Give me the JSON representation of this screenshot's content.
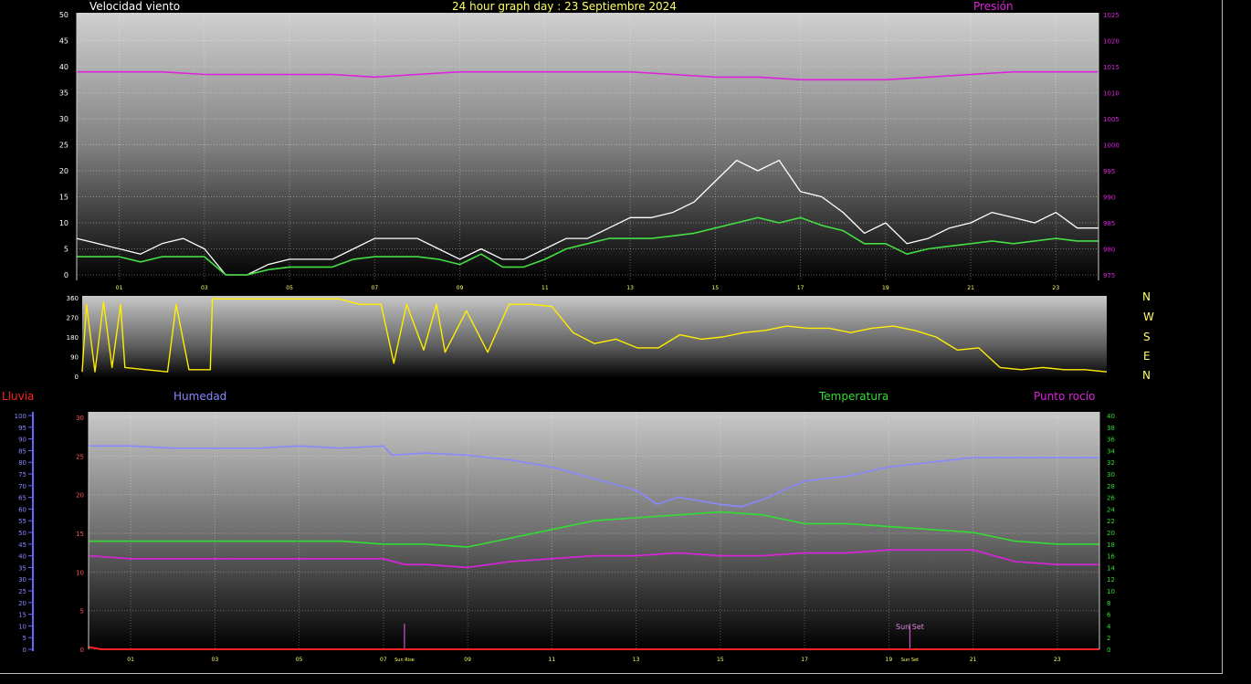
{
  "header": {
    "wind_title": "Velocidad viento",
    "date_title": "24 hour graph day : 23 Septiembre 2024",
    "pressure_title": "Presión"
  },
  "colors": {
    "wind": "#ffffff",
    "wind_avg": "#44dd44",
    "pressure": "#dd22dd",
    "direction": "#ffee00",
    "humidity": "#8888ff",
    "temperature": "#33dd33",
    "dewpoint": "#dd22dd",
    "rain": "#ff2222",
    "sun_marker": "#cc55cc"
  },
  "direction_labels": [
    "N",
    "W",
    "S",
    "E",
    "N"
  ],
  "lower_header": {
    "rain_title": "Lluvia",
    "humidity_title": "Humedad",
    "temperature_title": "Temperatura",
    "dewpoint_title": "Punto rocío"
  },
  "chart_data": [
    {
      "type": "line",
      "x_ticks": [
        "01",
        "03",
        "05",
        "07",
        "09",
        "11",
        "13",
        "15",
        "17",
        "19",
        "21",
        "23"
      ],
      "y_left_ticks": [
        0,
        5,
        10,
        15,
        20,
        25,
        30,
        35,
        40,
        45,
        50
      ],
      "y_right_ticks": [
        975,
        980,
        985,
        990,
        995,
        1000,
        1005,
        1010,
        1015,
        1020,
        1025
      ],
      "ylim_left": [
        0,
        50
      ],
      "ylim_right": [
        975,
        1025
      ],
      "xlim": [
        0,
        24
      ],
      "grid": true,
      "series": [
        {
          "name": "Velocidad viento",
          "axis": "left",
          "x": [
            0,
            0.5,
            1,
            1.5,
            2,
            2.5,
            3,
            3.5,
            4,
            4.5,
            5,
            5.5,
            6,
            6.5,
            7,
            7.5,
            8,
            8.5,
            9,
            9.5,
            10,
            10.5,
            11,
            11.5,
            12,
            12.5,
            13,
            13.5,
            14,
            14.5,
            15,
            15.5,
            16,
            16.5,
            17,
            17.5,
            18,
            18.5,
            19,
            19.5,
            20,
            20.5,
            21,
            21.5,
            22,
            22.5,
            23,
            23.5,
            24
          ],
          "values": [
            7,
            6,
            5,
            4,
            6,
            7,
            5,
            0,
            0,
            2,
            3,
            3,
            3,
            5,
            7,
            7,
            7,
            5,
            3,
            5,
            3,
            3,
            5,
            7,
            7,
            9,
            11,
            11,
            12,
            14,
            18,
            22,
            20,
            22,
            16,
            15,
            12,
            8,
            10,
            6,
            7,
            9,
            10,
            12,
            11,
            10,
            12,
            9,
            9
          ]
        },
        {
          "name": "",
          "axis": "left",
          "x": [
            0,
            0.5,
            1,
            1.5,
            2,
            2.5,
            3,
            3.5,
            4,
            4.5,
            5,
            5.5,
            6,
            6.5,
            7,
            7.5,
            8,
            8.5,
            9,
            9.5,
            10,
            10.5,
            11,
            11.5,
            12,
            12.5,
            13,
            13.5,
            14,
            14.5,
            15,
            15.5,
            16,
            16.5,
            17,
            17.5,
            18,
            18.5,
            19,
            19.5,
            20,
            20.5,
            21,
            21.5,
            22,
            22.5,
            23,
            23.5,
            24
          ],
          "values": [
            3.5,
            3.5,
            3.5,
            2.5,
            3.5,
            3.5,
            3.5,
            0,
            0,
            1,
            1.5,
            1.5,
            1.5,
            3,
            3.5,
            3.5,
            3.5,
            3,
            2,
            4,
            1.5,
            1.5,
            3,
            5,
            6,
            7,
            7,
            7,
            7.5,
            8,
            9,
            10,
            11,
            10,
            11,
            9.5,
            8.5,
            6,
            6,
            4,
            5,
            5.5,
            6,
            6.5,
            6,
            6.5,
            7,
            6.5,
            6.5
          ]
        },
        {
          "name": "Presión",
          "axis": "right",
          "x": [
            0,
            1,
            2,
            3,
            4,
            5,
            6,
            7,
            8,
            9,
            10,
            11,
            12,
            13,
            14,
            15,
            16,
            17,
            18,
            19,
            20,
            21,
            22,
            23,
            24
          ],
          "values": [
            1014,
            1014,
            1014,
            1013.5,
            1013.5,
            1013.5,
            1013.5,
            1013,
            1013.5,
            1014,
            1014,
            1014,
            1014,
            1014,
            1013.5,
            1013,
            1013,
            1012.5,
            1012.5,
            1012.5,
            1013,
            1013.5,
            1014,
            1014,
            1014
          ]
        }
      ]
    },
    {
      "type": "line",
      "y_ticks": [
        0,
        90,
        180,
        270,
        360
      ],
      "ylim": [
        0,
        360
      ],
      "xlim": [
        0,
        24
      ],
      "series": [
        {
          "name": "",
          "x": [
            0,
            0.1,
            0.3,
            0.5,
            0.7,
            0.9,
            1,
            1.5,
            2,
            2.2,
            2.5,
            3,
            3.05,
            3.5,
            4,
            5,
            6,
            6.5,
            7,
            7.3,
            7.6,
            8,
            8.3,
            8.5,
            9,
            9.5,
            10,
            10.5,
            11,
            11.5,
            12,
            12.5,
            13,
            13.5,
            14,
            14.5,
            15,
            15.5,
            16,
            16.5,
            17,
            17.5,
            18,
            18.5,
            19,
            19.5,
            20,
            20.5,
            21,
            21.5,
            22,
            22.5,
            23,
            23.5,
            24
          ],
          "values": [
            20,
            330,
            20,
            340,
            40,
            330,
            40,
            30,
            20,
            330,
            30,
            30,
            355,
            355,
            355,
            355,
            355,
            330,
            330,
            60,
            330,
            120,
            330,
            110,
            300,
            110,
            330,
            330,
            320,
            200,
            150,
            170,
            130,
            130,
            190,
            170,
            180,
            200,
            210,
            230,
            220,
            220,
            200,
            220,
            230,
            210,
            180,
            120,
            130,
            40,
            30,
            40,
            30,
            30,
            20
          ]
        }
      ]
    },
    {
      "type": "line",
      "x_ticks": [
        "01",
        "03",
        "05",
        "07",
        "09",
        "11",
        "13",
        "15",
        "17",
        "19",
        "21",
        "23"
      ],
      "y_left_ticks": [
        0,
        5,
        10,
        15,
        20,
        25,
        30
      ],
      "y_right_ticks": [
        0,
        2,
        4,
        6,
        8,
        10,
        12,
        14,
        16,
        18,
        20,
        22,
        24,
        26,
        28,
        30,
        32,
        34,
        36,
        38,
        40
      ],
      "y_humidity_ticks": [
        0,
        5,
        10,
        15,
        20,
        25,
        30,
        35,
        40,
        45,
        50,
        55,
        60,
        65,
        70,
        75,
        80,
        85,
        90,
        95,
        100
      ],
      "ylim_left": [
        0,
        30
      ],
      "ylim_right": [
        0,
        40
      ],
      "ylim_humidity": [
        0,
        100
      ],
      "xlim": [
        0,
        24
      ],
      "grid": true,
      "annotations": [
        {
          "text": "Sun Rise",
          "x": 7.5
        },
        {
          "text": "Sun Set",
          "x": 19.5
        }
      ],
      "series": [
        {
          "name": "Humedad",
          "axis": "humidity",
          "x": [
            0,
            1,
            2,
            3,
            4,
            5,
            6,
            7,
            7.2,
            8,
            9,
            10,
            11,
            12,
            13,
            13.5,
            14,
            15,
            15.5,
            16,
            17,
            18,
            19,
            20,
            21,
            22,
            23,
            24
          ],
          "values": [
            87,
            87,
            86,
            86,
            86,
            87,
            86,
            87,
            83,
            84,
            83,
            81,
            78,
            73,
            68,
            62,
            65,
            62,
            61,
            64,
            72,
            74,
            78,
            80,
            82,
            82,
            82,
            82
          ],
          "draw_values_in_temperature_units": true
        },
        {
          "name": "Temperatura",
          "axis": "right",
          "x": [
            0,
            1,
            2,
            3,
            4,
            5,
            6,
            7,
            8,
            9,
            10,
            11,
            12,
            13,
            14,
            15,
            16,
            17,
            18,
            19,
            20,
            21,
            22,
            23,
            24
          ],
          "values": [
            18.5,
            18.5,
            18.5,
            18.5,
            18.5,
            18.5,
            18.5,
            18,
            18,
            17.5,
            19,
            20.5,
            22,
            22.5,
            23,
            23.5,
            23,
            21.5,
            21.5,
            21,
            20.5,
            20,
            18.5,
            18,
            18
          ]
        },
        {
          "name": "Punto rocío",
          "axis": "right",
          "x": [
            0,
            1,
            2,
            3,
            4,
            5,
            6,
            7,
            7.5,
            8,
            9,
            10,
            11,
            12,
            13,
            14,
            15,
            16,
            17,
            18,
            19,
            20,
            21,
            22,
            23,
            24
          ],
          "values": [
            16,
            15.5,
            15.5,
            15.5,
            15.5,
            15.5,
            15.5,
            15.5,
            14.5,
            14.5,
            14,
            15,
            15.5,
            16,
            16,
            16.5,
            16,
            16,
            16.5,
            16.5,
            17,
            17,
            17,
            15,
            14.5,
            14.5
          ]
        },
        {
          "name": "Lluvia",
          "axis": "left",
          "x": [
            0,
            0.3,
            24
          ],
          "values": [
            0.3,
            0,
            0
          ]
        }
      ]
    }
  ]
}
